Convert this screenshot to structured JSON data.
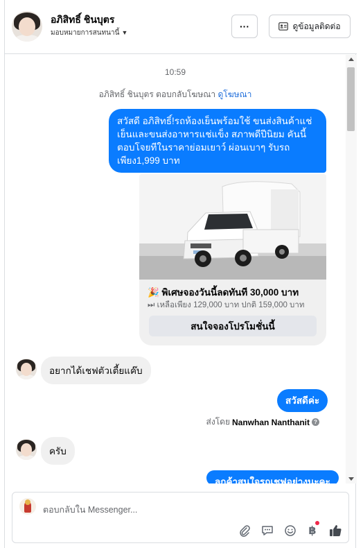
{
  "header": {
    "name": "อภิสิทธิ์ ชินบุตร",
    "assign": "มอบหมายการสนทนานี้",
    "more_label": "···",
    "contact_label": "ดูข้อมูลติดต่อ"
  },
  "conversation": {
    "time": "10:59",
    "reply_ad_text": "อภิสิทธิ์ ชินบุตร ตอบกลับโฆษณา",
    "reply_ad_link": "ดูโฆษณา",
    "ad_message": "สวัสดี อภิสิทธิ์!รถห้องเย็นพร้อมใช้ ขนส่งสินค้าแช่เย็นและขนส่งอาหารแช่แข็ง สภาพดีปีนิยม คันนี้ตอบโจยทีในราคาย่อมเยาว์ ผ่อนเบาๆ รับรถเพียง1,999 บาท",
    "card": {
      "title": "🎉 พิเศษจองวันนี้ลดทันที 30,000 บาท",
      "subtitle": "⏭ เหลือเพียง 129,000 บาท ปกติ 159,000 บาท",
      "button": "สนใจจองโปรโมชั่นนี้"
    },
    "incoming_1": "อยากได้เชฟตัวเตี้ยแค๊บ",
    "outgoing_1": "สวัสดีค่ะ",
    "sent_by_prefix": "ส่งโดย",
    "sent_by_name": "Nanwhan Nanthanit",
    "incoming_2": "ครับ",
    "outgoing_2": "ลูกค้าสนใจรถเชฟอย่างนะคะ"
  },
  "composer": {
    "placeholder": "ตอบกลับใน Messenger...",
    "baht_symbol": "฿"
  },
  "colors": {
    "accent": "#0a7cff",
    "link": "#216fdb",
    "notification": "#f02849"
  },
  "icons": [
    "chevron-down-icon",
    "contact-card-icon",
    "info-icon",
    "attachment-icon",
    "saved-replies-icon",
    "emoji-icon",
    "baht-icon",
    "like-icon",
    "scroll-up-icon",
    "scroll-down-icon"
  ]
}
